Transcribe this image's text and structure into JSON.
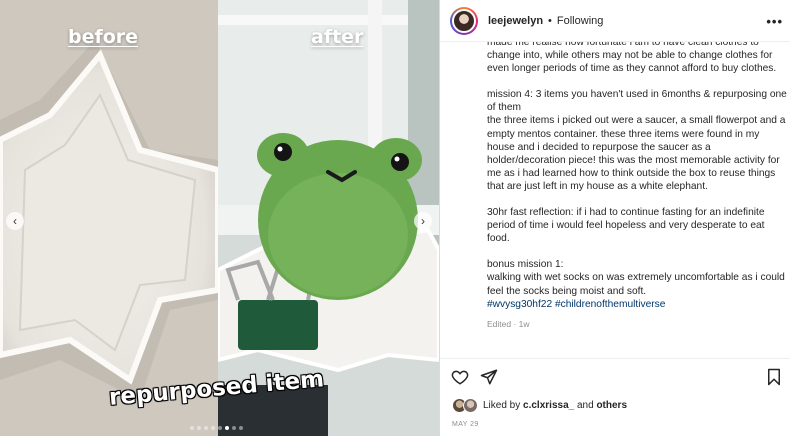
{
  "media": {
    "label_before": "before",
    "label_after": "after",
    "caption": "repurposed item",
    "carousel_total": 8,
    "carousel_active_index": 5
  },
  "post": {
    "username": "leejewelyn",
    "separator": "•",
    "follow_status": "Following",
    "paragraphs": [
      "made me realise how fortunate i am to have clean clothes to change into, while others may not be able to change clothes for even longer periods of time as they cannot afford to buy clothes.",
      "mission 4: 3 items you haven't used in 6months & repurposing one of them\nthe three items i picked out were a saucer, a small flowerpot and a empty mentos container. these three items were found in my house and i decided to repurpose the saucer as a holder/decoration piece! this was the most memorable activity for me as i had learned how to think outside the box to reuse things that are just left in my house as a white elephant.",
      "30hr fast reflection: if i had to continue fasting for an indefinite period of time i would feel hopeless and very desperate to eat food.",
      "bonus mission 1:\nwalking with wet socks on was extremely uncomfortable as i could feel the socks being moist and soft."
    ],
    "hashtags": "#wvysg30hf22 #childrenofthemultiverse",
    "edited": "Edited · 1w",
    "likes_prefix": "Liked by",
    "likes_user": "c.clxrissa_",
    "likes_and": "and",
    "likes_others": "others",
    "date": "MAY 29"
  },
  "icons": {
    "more": "more-options-icon",
    "like": "heart-icon",
    "share": "share-icon",
    "save": "bookmark-icon",
    "prev": "chevron-left-icon",
    "next": "chevron-right-icon"
  },
  "colors": {
    "link": "#00376b",
    "muted": "#8e8e8e",
    "text": "#262626"
  }
}
